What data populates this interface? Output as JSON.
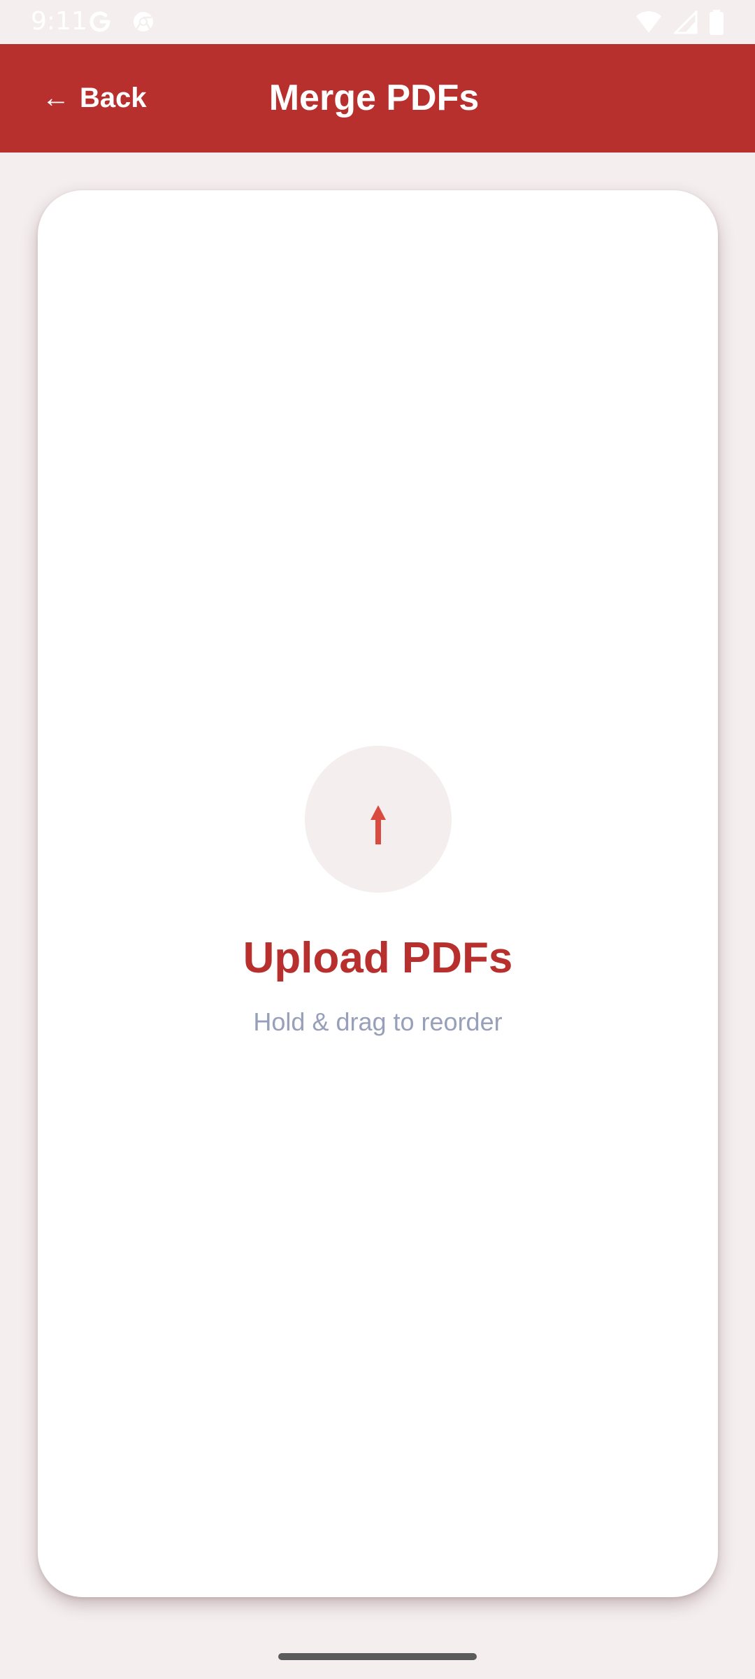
{
  "status_bar": {
    "time": "9:11",
    "left_icons": [
      "google-icon",
      "chrome-icon"
    ],
    "right_icons": [
      "wifi-icon",
      "cell-signal-icon",
      "battery-icon"
    ]
  },
  "app_bar": {
    "back_arrow": "←",
    "back_label": "Back",
    "title": "Merge PDFs"
  },
  "upload": {
    "icon": "upload-arrow-icon",
    "title": "Upload PDFs",
    "hint": "Hold & drag to reorder"
  },
  "colors": {
    "accent": "#B7302E",
    "icon_red": "#D84B3E",
    "background": "#F4EEEF",
    "card": "#FFFFFF",
    "hint_text": "#97A0B8"
  }
}
